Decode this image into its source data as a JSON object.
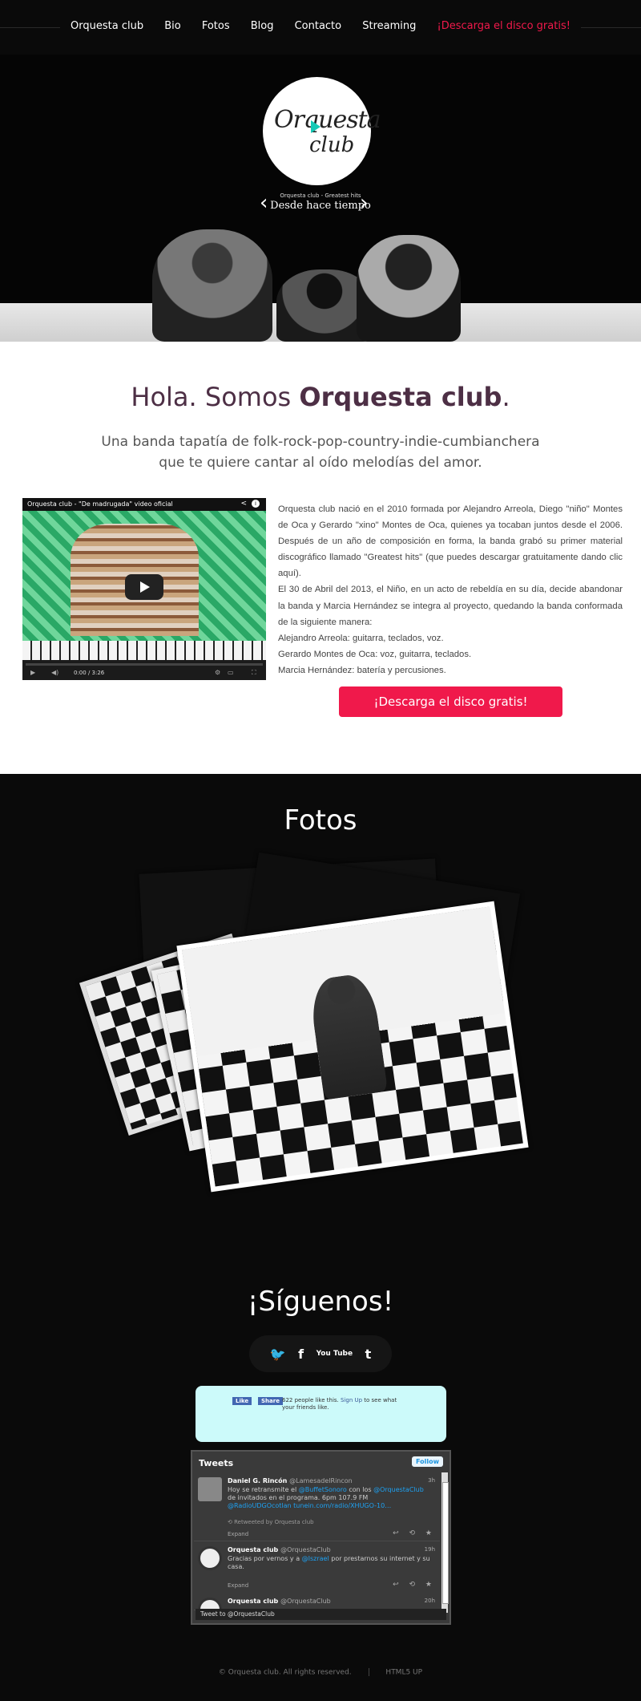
{
  "nav": {
    "items": [
      "Orquesta club",
      "Bio",
      "Fotos",
      "Blog",
      "Contacto",
      "Streaming",
      "¡Descarga el disco gratis!"
    ]
  },
  "hero": {
    "logo_line1": "Orquesta",
    "logo_line2": "club",
    "album_subtitle": "Orquesta club - Greatest hits",
    "album_title": "Desde hace tiempo",
    "prev_arrow": "‹",
    "next_arrow": "›"
  },
  "about": {
    "title_prefix": "Hola. Somos ",
    "title_bold": "Orquesta club",
    "title_suffix": ".",
    "subtitle_line1": "Una banda tapatía de folk-rock-pop-country-indie-cumbianchera",
    "subtitle_line2": "que te quiere cantar al oído melodías del amor.",
    "video": {
      "title": "Orquesta club - \"De madrugada\" video oficial",
      "time": "0:00 / 3:26"
    },
    "paragraphs": [
      "Orquesta club nació en el 2010 formada por Alejandro Arreola, Diego \"niño\" Montes de Oca y Gerardo \"xino\" Montes de Oca, quienes ya tocaban juntos desde el 2006. Después de un año de composición en forma, la banda grabó su primer material discográfico llamado \"Greatest hits\" (que puedes descargar gratuitamente dando clic aquí).",
      "El 30 de Abril del 2013, el Niño, en un acto de rebeldía en su día, decide abandonar la banda y Marcia Hernández se integra al proyecto, quedando la banda conformada de la siguiente manera:",
      "Alejandro Arreola: guitarra, teclados, voz.",
      "Gerardo Montes de Oca: voz, guitarra, teclados.",
      "Marcia Hernández: batería y percusiones."
    ],
    "download_button": "¡Descarga el disco gratis!"
  },
  "photos": {
    "title": "Fotos"
  },
  "follow": {
    "title": "¡Síguenos!",
    "social": [
      "twitter-icon",
      "facebook-icon",
      "youtube-icon",
      "tumblr-icon"
    ],
    "social_glyphs": [
      "🐦",
      "f",
      "You Tube",
      "t"
    ],
    "facebook": {
      "like": "Like",
      "share": "Share",
      "text": "622 people like this.",
      "signup": "Sign Up",
      "text_suffix": " to see what your friends like."
    },
    "twitter": {
      "header": "Tweets",
      "follow": "Follow",
      "tweets": [
        {
          "name": "Daniel G. Rincón",
          "handle": "@LamesadelRincon",
          "time": "3h",
          "text_parts": [
            "Hoy se retransmite el ",
            "@BuffetSonoro",
            " con los ",
            "@OrquestaClub",
            " de invitados en el programa. 6pm 107.9 FM ",
            "@RadioUDGOcotlan",
            " ",
            "tunein.com/radio/XHUGO-10…"
          ],
          "retweet": "Retweeted by Orquesta club",
          "expand": "Expand"
        },
        {
          "name": "Orquesta club",
          "handle": "@OrquestaClub",
          "time": "19h",
          "text_parts": [
            "Gracias por vernos y a ",
            "@Iszrael",
            " por prestarnos su internet y su casa."
          ],
          "expand": "Expand"
        },
        {
          "name": "Orquesta club",
          "handle": "@OrquestaClub",
          "time": "20h"
        }
      ],
      "compose": "Tweet to @OrquestaClub"
    }
  },
  "footer": {
    "copyright": "© Orquesta club. All rights reserved.",
    "html5": "HTML5 UP"
  },
  "colors": {
    "accent": "#f0194b",
    "title": "#4d2f45",
    "fb_box": "#ccfafa"
  }
}
